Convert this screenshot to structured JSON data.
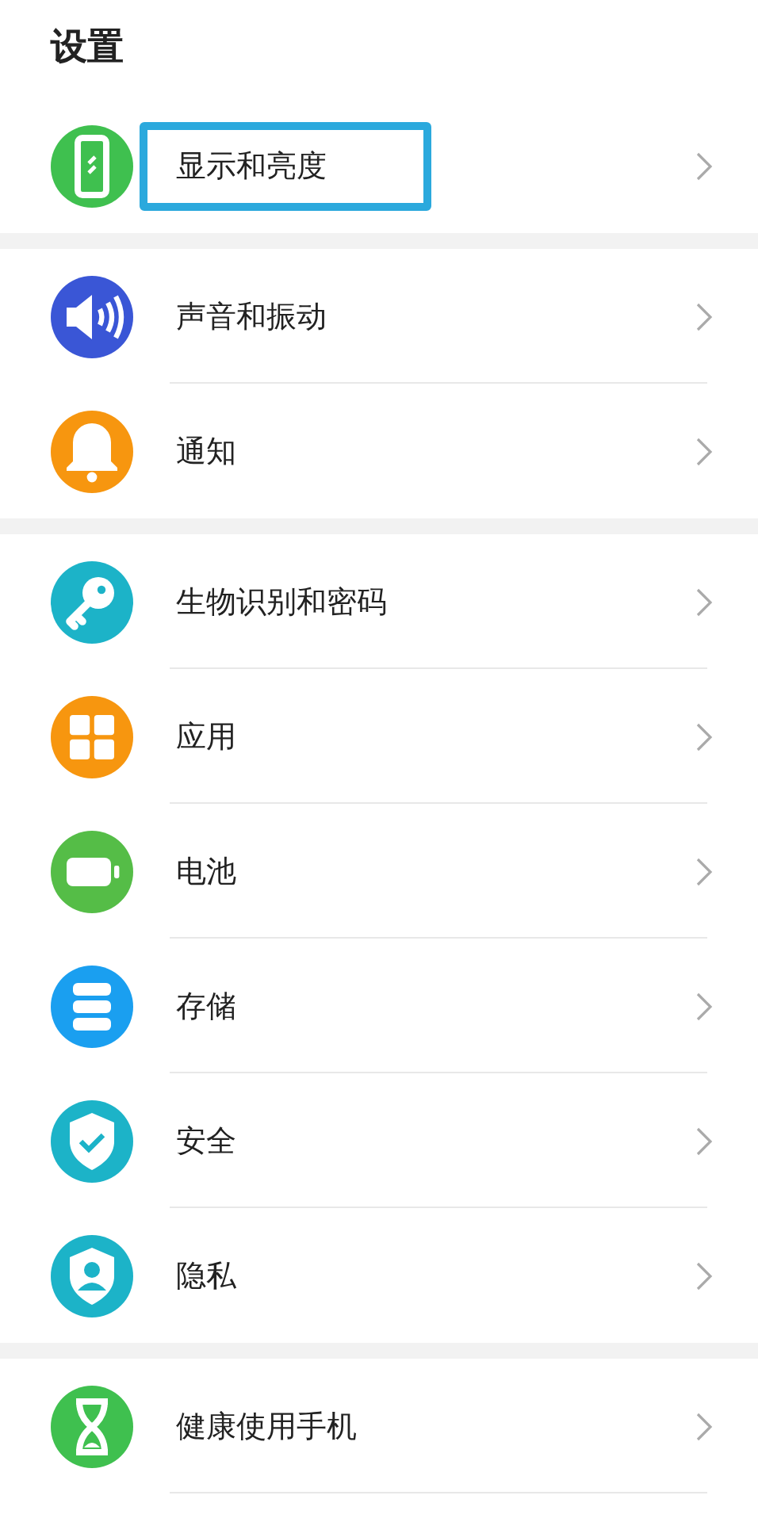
{
  "title": "设置",
  "groups": [
    {
      "items": [
        {
          "label": "显示和亮度",
          "kind": "phone",
          "color": "#3fc04f",
          "highlighted": true
        }
      ]
    },
    {
      "items": [
        {
          "label": "声音和振动",
          "kind": "speaker",
          "color": "#3a56d6",
          "highlighted": false
        },
        {
          "label": "通知",
          "kind": "bell",
          "color": "#f7960f",
          "highlighted": false
        }
      ]
    },
    {
      "items": [
        {
          "label": "生物识别和密码",
          "kind": "key",
          "color": "#1cb3c8",
          "highlighted": false
        },
        {
          "label": "应用",
          "kind": "grid",
          "color": "#f7960f",
          "highlighted": false
        },
        {
          "label": "电池",
          "kind": "battery",
          "color": "#55bd47",
          "highlighted": false
        },
        {
          "label": "存储",
          "kind": "storage",
          "color": "#1a9ff0",
          "highlighted": false
        },
        {
          "label": "安全",
          "kind": "shield",
          "color": "#1cb3c8",
          "highlighted": false
        },
        {
          "label": "隐私",
          "kind": "privacy",
          "color": "#1cb3c8",
          "highlighted": false
        }
      ]
    },
    {
      "items": [
        {
          "label": "健康使用手机",
          "kind": "hourglass",
          "color": "#3fc04f",
          "highlighted": false
        }
      ]
    }
  ]
}
